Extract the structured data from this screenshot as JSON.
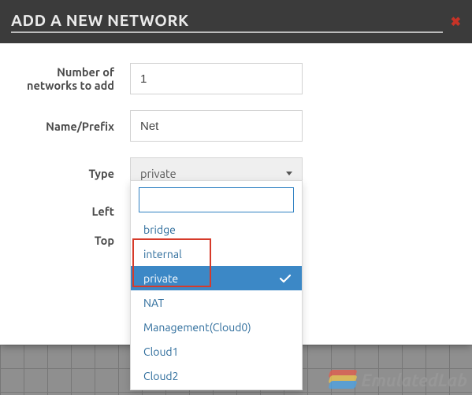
{
  "dialog": {
    "title": "ADD A NEW NETWORK",
    "close_icon": "✖"
  },
  "form": {
    "number": {
      "label": "Number of networks to add",
      "value": "1"
    },
    "name": {
      "label": "Name/Prefix",
      "value": "Net"
    },
    "type": {
      "label": "Type",
      "selected": "private"
    },
    "left": {
      "label": "Left"
    },
    "top": {
      "label": "Top"
    }
  },
  "type_options": {
    "search": "",
    "items": [
      {
        "label": "bridge"
      },
      {
        "label": "internal"
      },
      {
        "label": "private",
        "selected": true
      },
      {
        "label": "NAT"
      },
      {
        "label": "Management(Cloud0)"
      },
      {
        "label": "Cloud1"
      },
      {
        "label": "Cloud2"
      }
    ]
  },
  "watermark": {
    "text": "EmulatedLab"
  }
}
